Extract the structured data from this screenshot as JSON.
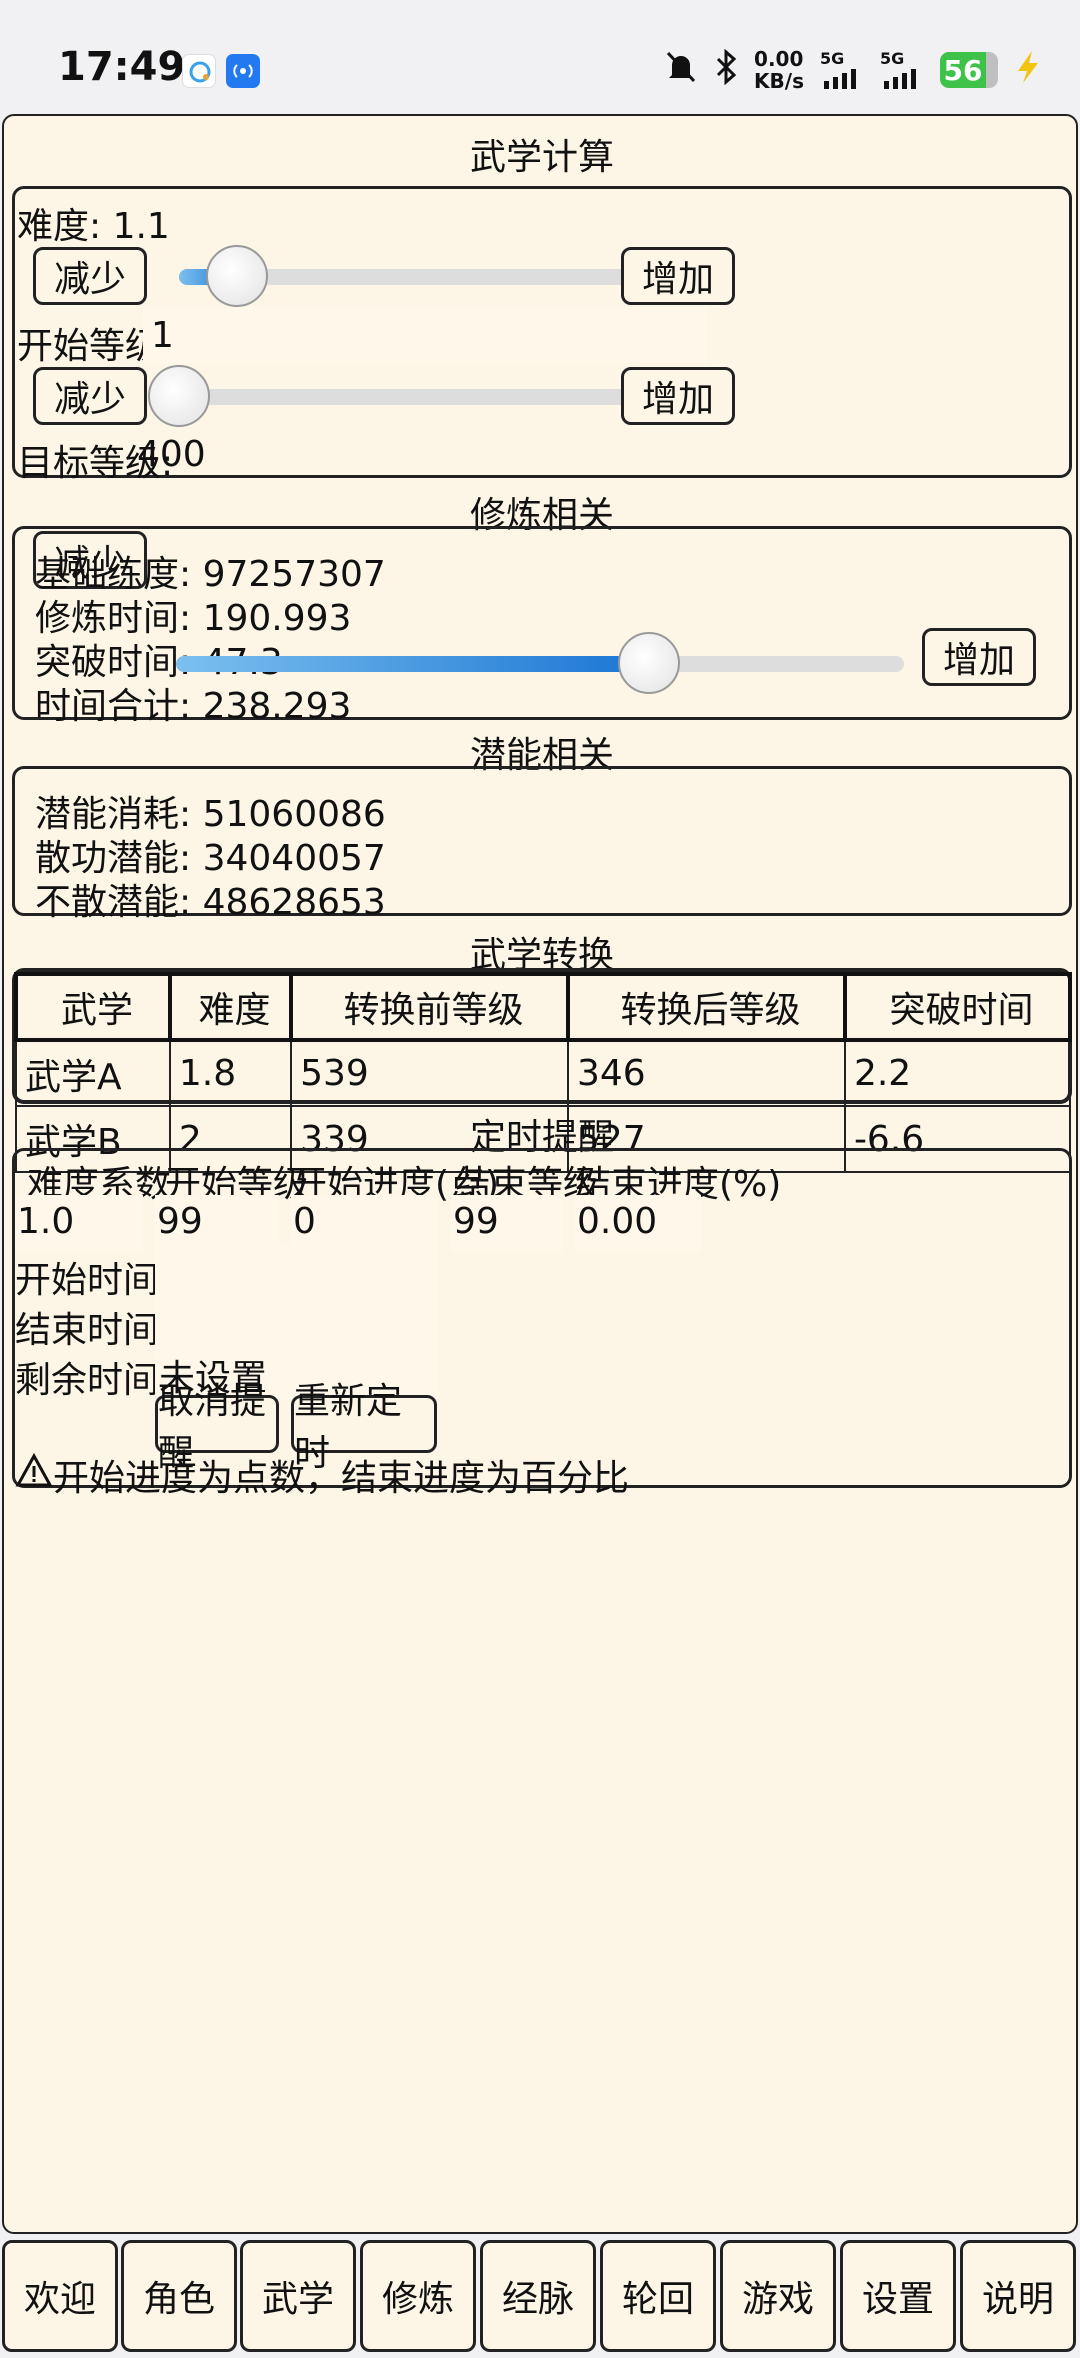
{
  "status_bar": {
    "time": "17:49",
    "net_speed_value": "0.00",
    "net_speed_unit": "KB/s",
    "sim1": "5G",
    "sim2": "5G",
    "battery": "56"
  },
  "calc": {
    "title": "武学计算",
    "difficulty": {
      "label": "难度: 1.1",
      "dec": "减少",
      "inc": "增加",
      "level": 0.12
    },
    "start_level": {
      "label": "开始等级：",
      "value": "1",
      "dec": "减少",
      "inc": "增加",
      "level": 0.0
    },
    "target_level": {
      "label": "目标等级:",
      "value": "400",
      "dec": "减少",
      "inc": "增加",
      "level": 0.65
    }
  },
  "training": {
    "title": "修炼相关",
    "items": [
      "基础练度: 97257307",
      "修炼时间: 190.993",
      "突破时间: 47.3",
      "时间合计: 238.293"
    ]
  },
  "potential": {
    "title": "潜能相关",
    "items": [
      "潜能消耗: 51060086",
      "散功潜能: 34040057",
      "不散潜能: 48628653"
    ]
  },
  "convert": {
    "title": "武学转换",
    "headers": [
      "武学",
      "难度",
      "转换前等级",
      "转换后等级",
      "突破时间"
    ],
    "rows": [
      [
        "武学A",
        "1.8",
        "539",
        "346",
        "2.2"
      ],
      [
        "武学B",
        "2",
        "339",
        "527",
        "-6.6"
      ]
    ]
  },
  "reminder": {
    "title": "定时提醒",
    "headers": [
      "难度系数",
      "开始等级",
      "开始进度(点)",
      "结束等级",
      "结束进度(%)"
    ],
    "values": [
      "1.0",
      "99",
      "0",
      "99",
      "0.00"
    ],
    "start_time_label": "开始时间",
    "end_time_label": "结束时间",
    "remaining_label": "剩余时间：",
    "remaining_value": "未设置",
    "cancel": "取消提醒",
    "reset": "重新定时",
    "note": "开始进度为点数，结束进度为百分比"
  },
  "tabs": [
    "欢迎",
    "角色",
    "武学",
    "修炼",
    "经脉",
    "轮回",
    "游戏",
    "设置",
    "说明"
  ]
}
